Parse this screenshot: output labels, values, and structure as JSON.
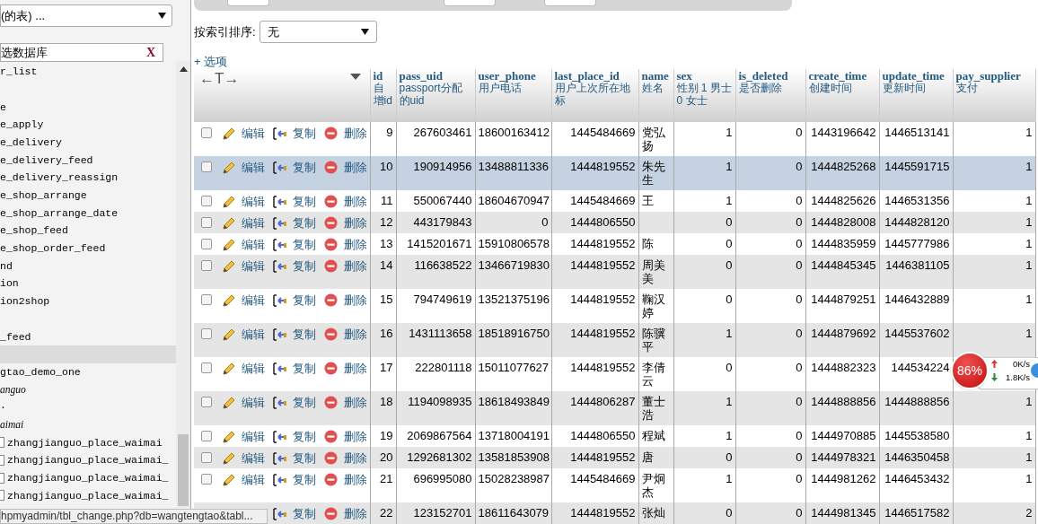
{
  "sidebar": {
    "db_select": "(的表) ...",
    "filter": {
      "value": "选数据库",
      "clear": "X"
    },
    "items": [
      {
        "kind": "table",
        "label": "r_list",
        "selected": false
      },
      {
        "kind": "spacer"
      },
      {
        "kind": "table",
        "label": "e",
        "selected": false
      },
      {
        "kind": "table",
        "label": "e_apply",
        "selected": false
      },
      {
        "kind": "table",
        "label": "e_delivery",
        "selected": false
      },
      {
        "kind": "table",
        "label": "e_delivery_feed",
        "selected": false
      },
      {
        "kind": "table",
        "label": "e_delivery_reassign",
        "selected": false
      },
      {
        "kind": "table",
        "label": "e_shop_arrange",
        "selected": false
      },
      {
        "kind": "table",
        "label": "e_shop_arrange_date",
        "selected": false
      },
      {
        "kind": "table",
        "label": "e_shop_feed",
        "selected": false
      },
      {
        "kind": "table",
        "label": "e_shop_order_feed",
        "selected": false
      },
      {
        "kind": "table",
        "label": "nd",
        "selected": false
      },
      {
        "kind": "table",
        "label": "ion",
        "selected": false
      },
      {
        "kind": "table",
        "label": "ion2shop",
        "selected": false
      },
      {
        "kind": "spacer"
      },
      {
        "kind": "table",
        "label": "_feed",
        "selected": false
      },
      {
        "kind": "table",
        "selected": true
      },
      {
        "kind": "table",
        "label": "gtao_demo_one",
        "selected": false
      },
      {
        "kind": "database",
        "label": "anguo",
        "selected": false
      },
      {
        "kind": "table",
        "label": "·",
        "selected": false
      },
      {
        "kind": "database",
        "label": "aimai",
        "selected": false
      },
      {
        "kind": "table_icon",
        "label": "zhangjianguo_place_waimai",
        "selected": false
      },
      {
        "kind": "table_icon",
        "label": "zhangjianguo_place_waimai_",
        "selected": false
      },
      {
        "kind": "table_icon",
        "label": "zhangjianguo_place_waimai_",
        "selected": false
      },
      {
        "kind": "table_icon",
        "label": "zhangjianguo_place_waimai_",
        "selected": false
      }
    ],
    "status_url": "hpmyadmin/tbl_change.php?db=wangtengtao&tabl..."
  },
  "main": {
    "sort": {
      "label": "按索引排序:",
      "value": "无"
    },
    "options_link": "+ 选项",
    "table": {
      "column_toggle": "←T→",
      "columns": [
        {
          "name": "id",
          "comment": "自增id"
        },
        {
          "name": "pass_uid",
          "comment": "passport分配的uid"
        },
        {
          "name": "user_phone",
          "comment": "用户电话"
        },
        {
          "name": "last_place_id",
          "comment": "用户上次所在地标"
        },
        {
          "name": "name",
          "comment": "姓名"
        },
        {
          "name": "sex",
          "comment": "性别 1 男士 0 女士"
        },
        {
          "name": "is_deleted",
          "comment": "是否删除"
        },
        {
          "name": "create_time",
          "comment": "创建时间"
        },
        {
          "name": "update_time",
          "comment": "更新时间"
        },
        {
          "name": "pay_supplier",
          "comment": "支付"
        }
      ],
      "rows": [
        {
          "selected": false,
          "checked": false,
          "actions": [
            "编辑",
            "复制",
            "删除"
          ],
          "cells": [
            "9",
            "267603461",
            "18600163412",
            "1445484669",
            "党弘扬",
            "1",
            "0",
            "1443196642",
            "1446513141",
            "1"
          ]
        },
        {
          "selected": true,
          "checked": false,
          "actions": [
            "编辑",
            "复制",
            "删除"
          ],
          "cells": [
            "10",
            "190914956",
            "13488811336",
            "1444819552",
            "朱先生",
            "1",
            "0",
            "1444825268",
            "1445591715",
            "1"
          ]
        },
        {
          "selected": false,
          "checked": false,
          "actions": [
            "编辑",
            "复制",
            "删除"
          ],
          "cells": [
            "11",
            "550067440",
            "18604670947",
            "1445484669",
            "王",
            "1",
            "0",
            "1444825626",
            "1446531356",
            "1"
          ]
        },
        {
          "selected": false,
          "checked": false,
          "actions": [
            "编辑",
            "复制",
            "删除"
          ],
          "cells": [
            "12",
            "443179843",
            "0",
            "1444806550",
            null,
            "0",
            "0",
            "1444828008",
            "1444828120",
            "1"
          ]
        },
        {
          "selected": false,
          "checked": false,
          "actions": [
            "编辑",
            "复制",
            "删除"
          ],
          "cells": [
            "13",
            "1415201671",
            "15910806578",
            "1444819552",
            "陈",
            "0",
            "0",
            "1444835959",
            "1445777986",
            "1"
          ]
        },
        {
          "selected": false,
          "checked": false,
          "actions": [
            "编辑",
            "复制",
            "删除"
          ],
          "cells": [
            "14",
            "116638522",
            "13466719830",
            "1444819552",
            "周美美",
            "0",
            "0",
            "1444845345",
            "1446381105",
            "1"
          ]
        },
        {
          "selected": false,
          "checked": false,
          "actions": [
            "编辑",
            "复制",
            "删除"
          ],
          "cells": [
            "15",
            "794749619",
            "13521375196",
            "1444819552",
            "鞠汉婷",
            "0",
            "0",
            "1444879251",
            "1446432889",
            "1"
          ]
        },
        {
          "selected": false,
          "checked": false,
          "actions": [
            "编辑",
            "复制",
            "删除"
          ],
          "cells": [
            "16",
            "1431113658",
            "18518916750",
            "1444819552",
            "陈骥平",
            "1",
            "0",
            "1444879692",
            "1445537602",
            "1"
          ]
        },
        {
          "selected": false,
          "checked": false,
          "actions": [
            "编辑",
            "复制",
            "删除"
          ],
          "cells": [
            "17",
            "222801118",
            "15011077627",
            "1444819552",
            "李倩云",
            "0",
            "0",
            "1444882323",
            "144534224",
            null
          ]
        },
        {
          "selected": false,
          "checked": false,
          "actions": [
            "编辑",
            "复制",
            "删除"
          ],
          "cells": [
            "18",
            "1194098935",
            "18618493849",
            "1444806287",
            "董士浩",
            "1",
            "0",
            "1444888856",
            "1444888856",
            "1"
          ]
        },
        {
          "selected": false,
          "checked": false,
          "actions": [
            "编辑",
            "复制",
            "删除"
          ],
          "cells": [
            "19",
            "2069867564",
            "13718004191",
            "1444806550",
            "程斌",
            "1",
            "0",
            "1444970885",
            "1445538580",
            "1"
          ]
        },
        {
          "selected": false,
          "checked": false,
          "actions": [
            "编辑",
            "复制",
            "删除"
          ],
          "cells": [
            "20",
            "1292681302",
            "13581853908",
            "1444819552",
            "唐",
            "0",
            "0",
            "1444978321",
            "1446350458",
            "1"
          ]
        },
        {
          "selected": false,
          "checked": false,
          "actions": [
            "编辑",
            "复制",
            "删除"
          ],
          "cells": [
            "21",
            "696995080",
            "15028238987",
            "1445484669",
            "尹炯杰",
            "1",
            "0",
            "1444981262",
            "1446453432",
            "1"
          ]
        },
        {
          "selected": false,
          "actions": [
            "复制",
            "删除"
          ],
          "cells": [
            "22",
            "123152701",
            "18611643079",
            "1444819552",
            "张灿",
            "0",
            "0",
            "1444981345",
            "1446517582",
            "2"
          ]
        }
      ]
    }
  },
  "net_monitor": {
    "percent": "86%",
    "up": "0K/s",
    "down": "1.8K/s"
  }
}
